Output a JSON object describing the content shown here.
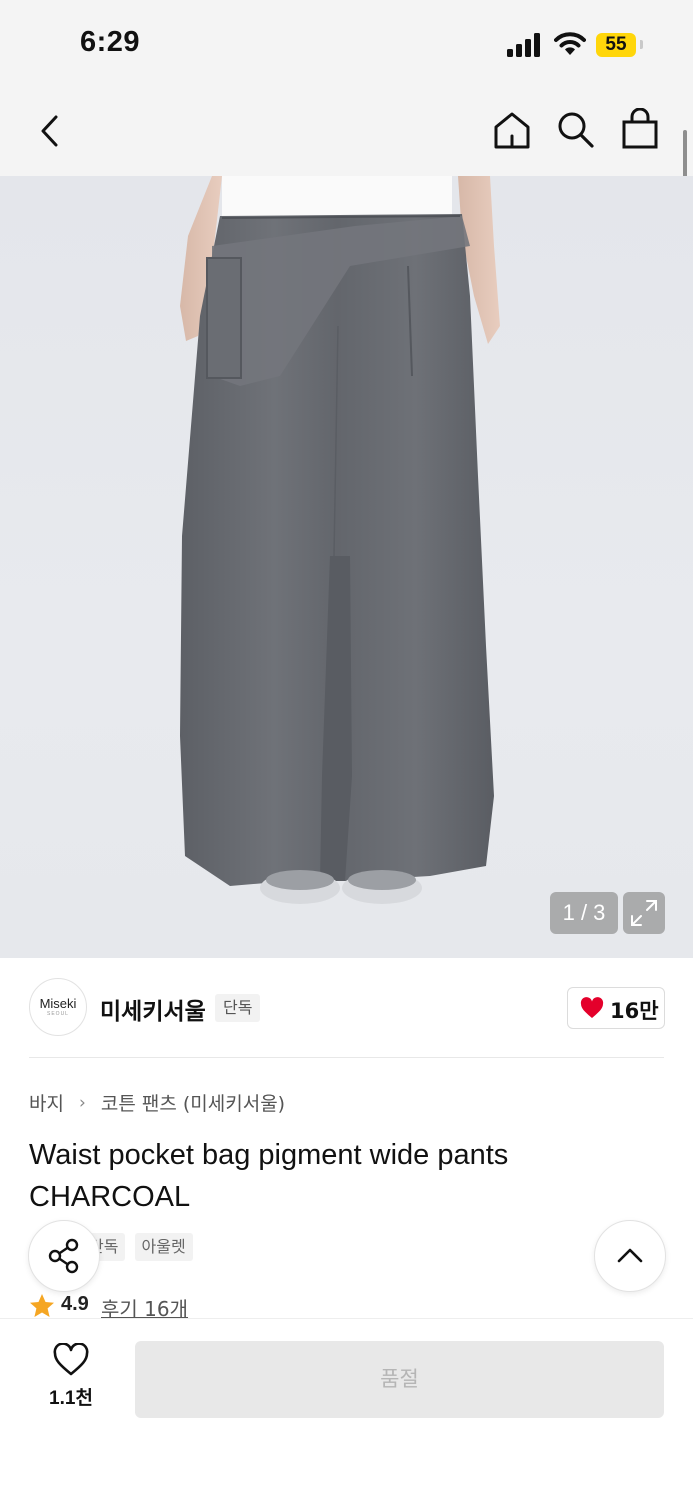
{
  "status_bar": {
    "time": "6:29",
    "battery": "55",
    "battery_color": "#ffd60a"
  },
  "nav": {
    "back_icon": "chevron-left-icon",
    "home_icon": "home-icon",
    "search_icon": "search-icon",
    "bag_icon": "shopping-bag-icon"
  },
  "gallery": {
    "counter": "1 / 3",
    "expand_icon": "expand-icon"
  },
  "brand": {
    "logo_text": "Miseki",
    "logo_subtext": "SEOUL",
    "name": "미세키서울",
    "badge": "단독",
    "likes": "16만",
    "heart_color": "#e4002b"
  },
  "breadcrumb": {
    "category": "바지",
    "subcategory": "코튼 팬츠 (미세키서울)"
  },
  "product": {
    "title": "Waist pocket bag pigment wide pants CHARCOAL",
    "tags": [
      "단독",
      "아울렛"
    ],
    "rating": "4.9",
    "reviews": "후기 16개",
    "star_color": "#f5a623"
  },
  "bottom": {
    "wish_count": "1.1천",
    "buy_label": "품절"
  }
}
